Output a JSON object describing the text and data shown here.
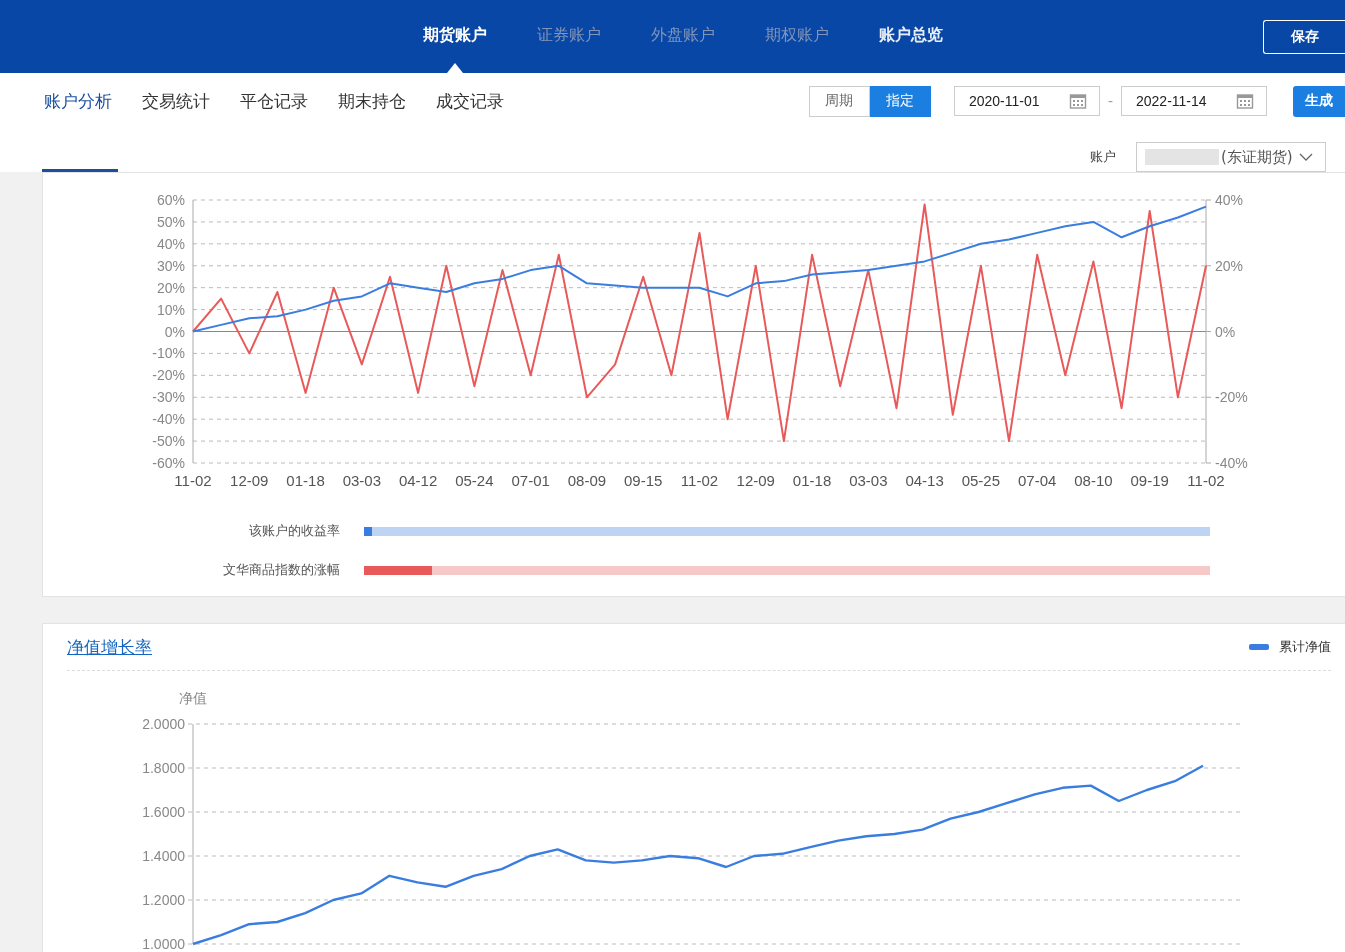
{
  "top_nav": {
    "tabs": [
      {
        "label": "期货账户",
        "selected": true,
        "disabled": false
      },
      {
        "label": "证券账户",
        "selected": false,
        "disabled": true
      },
      {
        "label": "外盘账户",
        "selected": false,
        "disabled": true
      },
      {
        "label": "期权账户",
        "selected": false,
        "disabled": true
      },
      {
        "label": "账户总览",
        "selected": false,
        "disabled": false
      }
    ],
    "save_button": "保存"
  },
  "sub_nav": {
    "tabs": [
      {
        "label": "账户分析",
        "selected": true
      },
      {
        "label": "交易统计",
        "selected": false
      },
      {
        "label": "平仓记录",
        "selected": false
      },
      {
        "label": "期末持仓",
        "selected": false
      },
      {
        "label": "成交记录",
        "selected": false
      }
    ],
    "mode_toggle": [
      {
        "label": "周期",
        "selected": false
      },
      {
        "label": "指定",
        "selected": true
      }
    ],
    "start_date": "2020-11-01",
    "date_separator": "-",
    "end_date": "2022-11-14",
    "generate_button": "生成",
    "account_label": "账户",
    "account_value": "(东证期货)"
  },
  "return_chart": {
    "chart_data": {
      "type": "line",
      "grid": true,
      "categories": [
        "11-02",
        null,
        "12-09",
        null,
        "01-18",
        null,
        "03-03",
        null,
        "04-12",
        null,
        "05-24",
        null,
        "07-01",
        null,
        "08-09",
        null,
        "09-15",
        null,
        "11-02",
        null,
        "12-09",
        null,
        "01-18",
        null,
        "03-03",
        null,
        "04-13",
        null,
        "05-25",
        null,
        "07-04",
        null,
        "08-10",
        null,
        "09-19",
        null,
        "11-02"
      ],
      "ylim": [
        -60,
        60
      ],
      "yticks": [
        {
          "value": 60,
          "label": "60%"
        },
        {
          "value": 50,
          "label": "50%"
        },
        {
          "value": 40,
          "label": "40%"
        },
        {
          "value": 30,
          "label": "30%"
        },
        {
          "value": 20,
          "label": "20%"
        },
        {
          "value": 10,
          "label": "10%"
        },
        {
          "value": 0,
          "label": "0%"
        },
        {
          "value": -10,
          "label": "-10%"
        },
        {
          "value": -20,
          "label": "-20%"
        },
        {
          "value": -30,
          "label": "-30%"
        },
        {
          "value": -40,
          "label": "-40%"
        },
        {
          "value": -50,
          "label": "-50%"
        },
        {
          "value": -60,
          "label": "-60%"
        }
      ],
      "series": [
        {
          "name": "该账户的收益率",
          "color": "#3a7de0",
          "values": [
            0,
            3,
            6,
            7,
            10,
            14,
            16,
            22,
            20,
            18,
            22,
            24,
            28,
            30,
            22,
            21,
            20,
            20,
            20,
            16,
            22,
            23,
            26,
            27,
            28,
            30,
            32,
            36,
            40,
            42,
            45,
            48,
            50,
            43,
            48,
            52,
            57
          ]
        },
        {
          "name": "文华商品指数的涨幅",
          "color": "#e85a5a",
          "values": [
            0,
            15,
            -10,
            18,
            -28,
            20,
            -15,
            25,
            -28,
            30,
            -25,
            28,
            -20,
            35,
            -30,
            -15,
            25,
            -20,
            45,
            -40,
            30,
            -50,
            35,
            -25,
            28,
            -35,
            58,
            -38,
            30,
            -50,
            35,
            -20,
            32,
            -35,
            55,
            -30,
            30
          ]
        }
      ]
    },
    "right_axis_ticks": [
      "40%",
      "20%",
      "0%",
      "-20%",
      "-40%"
    ]
  },
  "progress": [
    {
      "level": 0.01
    },
    {
      "level": 0.08
    }
  ],
  "nav_card": {
    "title": "净值增长率",
    "ylabel": "净值",
    "chart_data": {
      "type": "line",
      "grid": true,
      "ylim": [
        1,
        2
      ],
      "yticks": [
        {
          "value": 2,
          "label": "2.0000"
        },
        {
          "value": 1.8,
          "label": "1.8000"
        },
        {
          "value": 1.6,
          "label": "1.6000"
        },
        {
          "value": 1.4,
          "label": "1.4000"
        },
        {
          "value": 1.2,
          "label": "1.2000"
        },
        {
          "value": 1,
          "label": "1.0000"
        }
      ],
      "series": [
        {
          "name": "累计净值",
          "color": "#3a7de0",
          "values": [
            1.0,
            1.04,
            1.09,
            1.1,
            1.14,
            1.2,
            1.23,
            1.31,
            1.28,
            1.26,
            1.31,
            1.34,
            1.4,
            1.43,
            1.38,
            1.37,
            1.38,
            1.4,
            1.39,
            1.35,
            1.4,
            1.41,
            1.44,
            1.47,
            1.49,
            1.5,
            1.52,
            1.57,
            1.6,
            1.64,
            1.68,
            1.71,
            1.72,
            1.65,
            1.7,
            1.74,
            1.81
          ]
        }
      ]
    }
  }
}
